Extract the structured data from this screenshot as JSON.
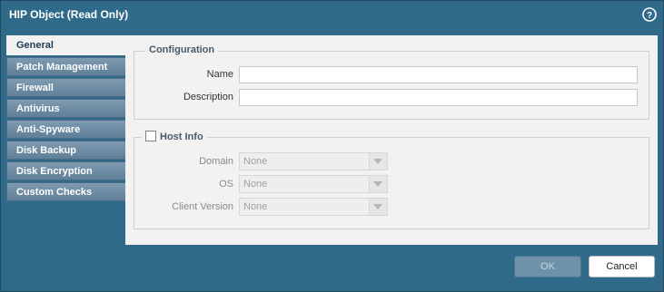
{
  "dialog": {
    "title": "HIP Object (Read Only)",
    "help_icon": "help-icon"
  },
  "tabs": [
    {
      "label": "General",
      "active": true
    },
    {
      "label": "Patch Management",
      "active": false
    },
    {
      "label": "Firewall",
      "active": false
    },
    {
      "label": "Antivirus",
      "active": false
    },
    {
      "label": "Anti-Spyware",
      "active": false
    },
    {
      "label": "Disk Backup",
      "active": false
    },
    {
      "label": "Disk Encryption",
      "active": false
    },
    {
      "label": "Custom Checks",
      "active": false
    }
  ],
  "configuration": {
    "legend": "Configuration",
    "name_label": "Name",
    "name_value": "",
    "description_label": "Description",
    "description_value": ""
  },
  "host_info": {
    "legend": "Host Info",
    "checked": false,
    "domain_label": "Domain",
    "domain_value": "None",
    "os_label": "OS",
    "os_value": "None",
    "client_version_label": "Client Version",
    "client_version_value": "None"
  },
  "buttons": {
    "ok_label": "OK",
    "cancel_label": "Cancel"
  },
  "colors": {
    "frame": "#2f6a8a",
    "tab_inactive": "#6f8ca3",
    "panel": "#f2f2f2"
  }
}
